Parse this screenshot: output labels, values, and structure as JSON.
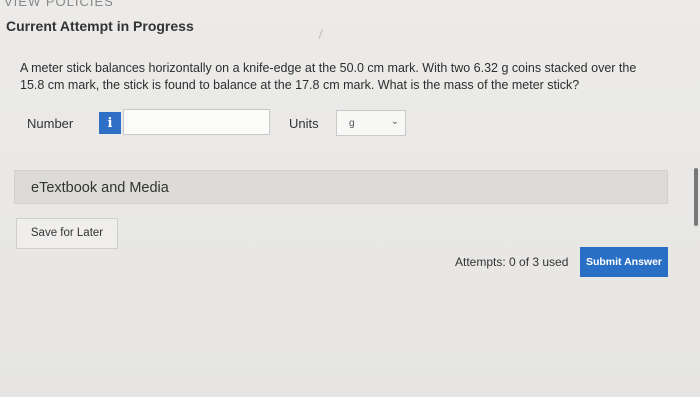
{
  "header": {
    "cut_off_text": "VIEW POLICIES",
    "title": "Current Attempt in Progress"
  },
  "question": {
    "text": "A meter stick balances horizontally on a knife-edge at the 50.0 cm mark. With two 6.32 g coins stacked over the 15.8 cm mark, the stick is found to balance at the 17.8 cm mark. What is the mass of the meter stick?"
  },
  "answer": {
    "number_label": "Number",
    "info_icon_glyph": "i",
    "number_value": "",
    "units_label": "Units",
    "units_selected": "g",
    "units_chevron": "⌄"
  },
  "etextbook": {
    "label": "eTextbook and Media"
  },
  "actions": {
    "save_label": "Save for Later",
    "attempts_text": "Attempts: 0 of 3 used",
    "submit_label": "Submit Answer"
  },
  "colors": {
    "accent": "#2a6fc6",
    "info_button": "#2f6fc8"
  },
  "icons": {
    "info": "info-icon",
    "dropdown": "chevron-down-icon"
  }
}
